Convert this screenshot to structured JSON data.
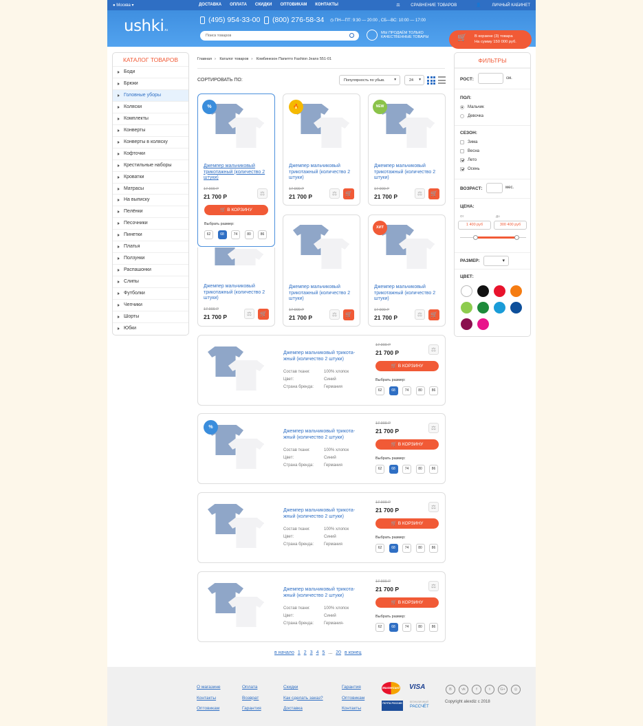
{
  "topbar": {
    "city": "Москва",
    "nav": [
      "ДОСТАВКА",
      "ОПЛАТА",
      "СКИДКИ",
      "ОПТОВИКАМ",
      "КОНТАКТЫ"
    ],
    "compare": "СРАВНЕНИЕ ТОВАРОВ",
    "cabinet": "ЛИЧНЫЙ КАБИНЕТ"
  },
  "header": {
    "logo": "ushki",
    "logo_suffix": ".ru",
    "phone1": "(495) 954-33-00",
    "phone2": "(800) 276-58-34",
    "hours": "ПН—ПТ: 9:30 — 20:00 , СБ—ВС: 10:00 — 17:00",
    "search_placeholder": "Поиск товаров",
    "quality_line1": "МЫ ПРОДАЁМ ТОЛЬКО",
    "quality_line2": "КАЧЕСТВЕННЫЕ ТОВАРЫ",
    "cart_line1": "В корзине (3) товара",
    "cart_line2": "На сумму 150 000 руб."
  },
  "catalog": {
    "title": "КАТАЛОГ ТОВАРОВ",
    "items": [
      "Боди",
      "Брюки",
      "Головные уборы",
      "Коляски",
      "Комплекты",
      "Конверты",
      "Конверты в коляску",
      "Кофточки",
      "Крестильные наборы",
      "Кроватки",
      "Матрасы",
      "На выписку",
      "Пелёнки",
      "Песочники",
      "Пинетки",
      "Платья",
      "Ползунки",
      "Распашонки",
      "Слипы",
      "Футболки",
      "Чепчики",
      "Шорты",
      "Юбки"
    ]
  },
  "breadcrumb": [
    "Главная",
    "Каталог товаров",
    "Комбинезон Папитто Fashion Jeans 551-01"
  ],
  "sort": {
    "label": "СОРТИРОВАТЬ ПО:",
    "value": "Популярность по убыв.",
    "count": "24"
  },
  "product": {
    "title": "Джемпер мальчиковый трикотажный (количество 2 штуки)",
    "list_title": "Джемпер мальчиковый трикота-жный (количество 2 штуки)",
    "old_price": "17 900 Р",
    "price": "21 700 Р",
    "cart": "В КОРЗИНУ",
    "size_label": "Выбрать размер:",
    "sizes": [
      "62",
      "68",
      "74",
      "80",
      "86"
    ]
  },
  "badges": {
    "sale": "%",
    "hot": "🔥",
    "new": "NEW",
    "hit": "ХИТ"
  },
  "specs": {
    "k1": "Состав ткани:",
    "v1": "100% хлопок",
    "k2": "Цвет:",
    "v2": "Синий",
    "k3": "Страна бренда:",
    "v3": "Германия",
    "v3_last": "Германия-"
  },
  "filters": {
    "title": "ФИЛЬТРЫ",
    "height": "РОСТ:",
    "height_unit": "см.",
    "gender": "ПОЛ:",
    "boy": "Мальчик",
    "girl": "Девочка",
    "season": "СЕЗОН:",
    "winter": "Зима",
    "spring": "Весна",
    "summer": "Лето",
    "autumn": "Осень",
    "age": "ВОЗРАСТ:",
    "age_unit": "мес.",
    "price": "ЦЕНА:",
    "from": "От",
    "to": "До",
    "price_from": "1 400 руб",
    "price_to": "300 400 руб",
    "size": "РАЗМЕР:",
    "color": "ЦВЕТ:"
  },
  "colors": [
    "#ffffff",
    "#111111",
    "#e8132c",
    "#f57c12",
    "#8dcc4e",
    "#1d8a3a",
    "#1a9cd8",
    "#0d4f9a",
    "#8a0f4e",
    "#e8158b"
  ],
  "pagination": [
    "в начало",
    "1",
    "2",
    "3",
    "4",
    "5",
    "...",
    "20",
    "в конец"
  ],
  "footer": {
    "col1": [
      "О магазине",
      "Контакты",
      "Оптовикам"
    ],
    "col2": [
      "Оплата",
      "Возврат",
      "Гарантия"
    ],
    "col3": [
      "Скидки",
      "Как сделать заказ?",
      "Доставка"
    ],
    "col4": [
      "Гарантия",
      "Оптовикам",
      "Контакты"
    ],
    "mastercard": "MasterCard",
    "visa": "VISA",
    "post": "ПОЧТА РОССИИ",
    "rassch": "РАССЧЁТ",
    "rassch_sub": "БЕЗНАЛИЧНЫЙ",
    "social": [
      "В",
      "vk",
      "f",
      "t",
      "G+",
      "◎"
    ],
    "copyright": "Copyright alexdiz  с  2018"
  }
}
